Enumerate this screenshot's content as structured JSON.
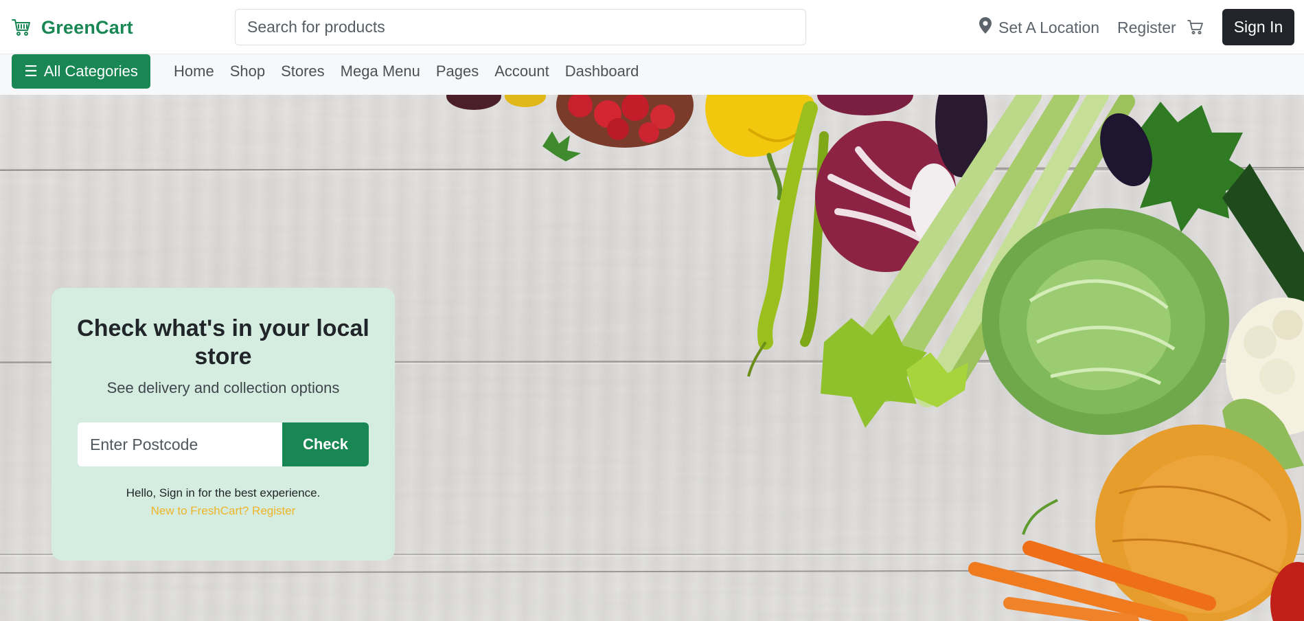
{
  "header": {
    "brand_name": "GreenCart",
    "brand_icon": "shopping-cart-icon",
    "search_placeholder": "Search for products",
    "location_label": "Set A Location",
    "location_icon": "map-pin-icon",
    "register_label": "Register",
    "cart_icon": "cart-icon",
    "signin_label": "Sign In"
  },
  "nav": {
    "categories_label": "All Categories",
    "categories_icon": "hamburger-icon",
    "links": [
      "Home",
      "Shop",
      "Stores",
      "Mega Menu",
      "Pages",
      "Account",
      "Dashboard"
    ]
  },
  "hero": {
    "title": "Check what's in your local store",
    "subtitle": "See delivery and collection options",
    "postcode_placeholder": "Enter Postcode",
    "check_label": "Check",
    "hello_text": "Hello, Sign in for the best experience.",
    "register_link": "New to FreshCart? Register"
  },
  "colors": {
    "brand": "#198754",
    "dark": "#212529",
    "card_bg": "#d4ede0",
    "link": "#f0b429",
    "muted": "#5c636a"
  }
}
